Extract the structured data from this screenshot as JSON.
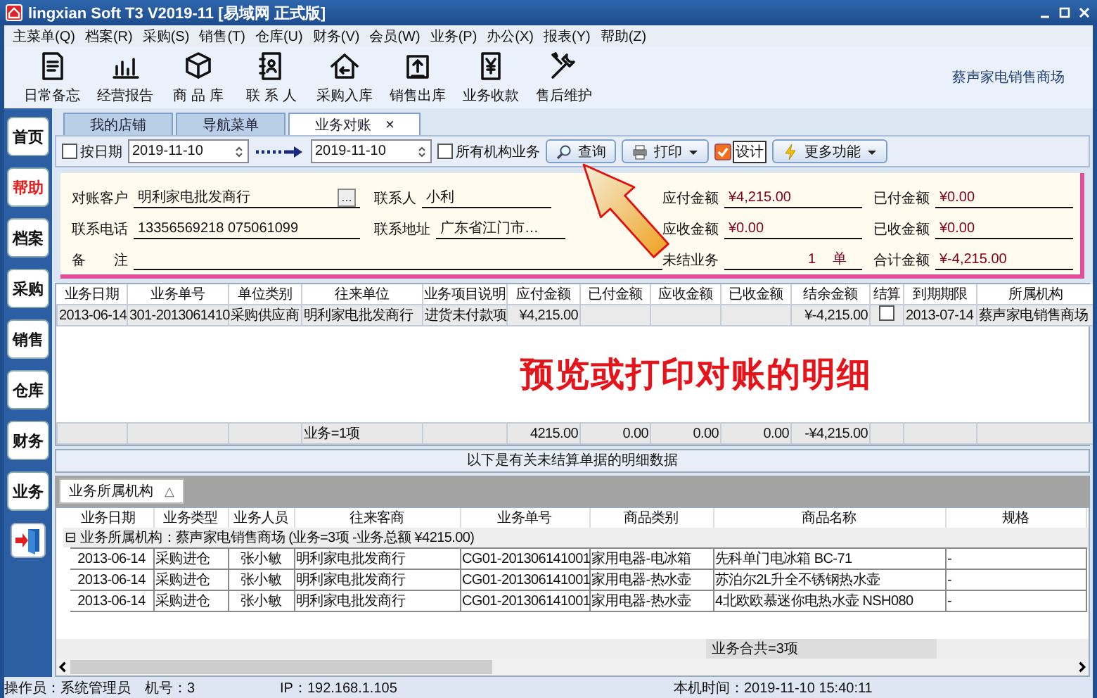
{
  "window": {
    "title": "lingxian Soft T3 V2019-11 [易域网 正式版]"
  },
  "menu": [
    "主菜单(Q)",
    "档案(R)",
    "采购(S)",
    "销售(T)",
    "仓库(U)",
    "财务(V)",
    "会员(W)",
    "业务(P)",
    "办公(X)",
    "报表(Y)",
    "帮助(Z)"
  ],
  "toolbar": [
    "日常备忘",
    "经营报告",
    "商 品 库",
    "联 系 人",
    "采购入库",
    "销售出库",
    "业务收款",
    "售后维护"
  ],
  "shop_name": "蔡声家电销售商场",
  "sidebar": [
    {
      "label": "首页",
      "highlighted": false
    },
    {
      "label": "帮助",
      "highlighted": true
    },
    {
      "label": "档案",
      "highlighted": false
    },
    {
      "label": "采购",
      "highlighted": false
    },
    {
      "label": "销售",
      "highlighted": false
    },
    {
      "label": "仓库",
      "highlighted": false
    },
    {
      "label": "财务",
      "highlighted": false
    },
    {
      "label": "业务",
      "highlighted": false
    }
  ],
  "tabs": [
    {
      "label": "我的店铺",
      "selected": false
    },
    {
      "label": "导航菜单",
      "selected": false
    },
    {
      "label": "业务对账",
      "selected": true,
      "close": "×"
    }
  ],
  "filter": [
    {
      "kind": "checkbox",
      "label": "按日期",
      "checked": false
    },
    {
      "kind": "date",
      "value": "2019-11-10"
    },
    {
      "kind": "range-arrow"
    },
    {
      "kind": "date",
      "value": "2019-11-10"
    },
    {
      "kind": "checkbox",
      "label": "所有机构业务",
      "checked": false
    },
    {
      "kind": "query",
      "label": "查询"
    },
    {
      "kind": "print",
      "label": "打印"
    },
    {
      "kind": "design",
      "label": "设计",
      "checked": true
    },
    {
      "kind": "more",
      "label": "更多功能"
    }
  ],
  "contact": [
    {
      "label": "对账客户",
      "value": "明利家电批发商行",
      "picker": "…"
    },
    {
      "label": "联系人",
      "value": "小利"
    },
    {
      "label": "联系电话",
      "value": "13356569218 075061099"
    },
    {
      "label": "联系地址",
      "value": "广东省江门市…"
    },
    {
      "label": "备　　注"
    }
  ],
  "amounts": [
    {
      "label": "应付金额",
      "value": "¥4,215.00"
    },
    {
      "label": "已付金额",
      "value": "¥0.00"
    },
    {
      "label": "应收金额",
      "value": "¥0.00"
    },
    {
      "label": "已收金额",
      "value": "¥0.00"
    },
    {
      "label": "未结业务",
      "value": "1",
      "unit": "单"
    },
    {
      "label": "合计金额",
      "value": "¥-4,215.00"
    }
  ],
  "grid": {
    "columns": [
      "业务日期",
      "业务单号",
      "单位类别",
      "往来单位",
      "业务项目说明",
      "应付金额",
      "已付金额",
      "应收金额",
      "已收金额",
      "结余金额",
      "结算",
      "到期期限",
      "所属机构"
    ],
    "rows": [
      {
        "date": "2013-06-14",
        "number": "301-2013061410",
        "unit_type": "采购供应商",
        "partner": "明利家电批发商行",
        "description": "进货未付款项",
        "payable": "¥4,215.00",
        "balance": "¥-4,215.00",
        "settled": false,
        "due": "2013-07-14",
        "org": "蔡声家电销售商场"
      }
    ],
    "totals": {
      "partner": "业务=1项",
      "payable": "4215.00",
      "paid": "0.00",
      "receivable": "0.00",
      "received": "0.00",
      "balance": "-¥4,215.00"
    }
  },
  "annotation": "预览或打印对账的明细",
  "info_bar": "以下是有关未结算单据的明细数据",
  "group_panel": {
    "chip": "业务所属机构",
    "sort": "△"
  },
  "detail_grid": {
    "columns": [
      "业务日期",
      "业务类型",
      "业务人员",
      "往来客商",
      "业务单号",
      "商品类别",
      "商品名称",
      "规格"
    ],
    "group": {
      "toggle": "⊟",
      "text": "业务所属机构：蔡声家电销售商场 (业务=3项 -业务总额 ¥4215.00)",
      "expanded": true
    },
    "rows": [
      [
        "2013-06-14",
        "采购进仓",
        "张小敏",
        "明利家电批发商行",
        "CG01-201306141001",
        "家用电器-电冰箱",
        "先科单门电冰箱 BC-71",
        "-"
      ],
      [
        "2013-06-14",
        "采购进仓",
        "张小敏",
        "明利家电批发商行",
        "CG01-201306141001",
        "家用电器-热水壶",
        "苏泊尔2L升全不锈钢热水壶",
        "-"
      ],
      [
        "2013-06-14",
        "采购进仓",
        "张小敏",
        "明利家电批发商行",
        "CG01-201306141001",
        "家用电器-热水壶",
        "4北欧欧慕迷你电热水壶 NSH080",
        "-"
      ]
    ],
    "footer": "业务合共=3项"
  },
  "status_bar": [
    "操作员：系统管理员",
    "机号：3",
    "IP：192.168.1.105",
    "本机时间：2019-11-10 15:40:11"
  ]
}
